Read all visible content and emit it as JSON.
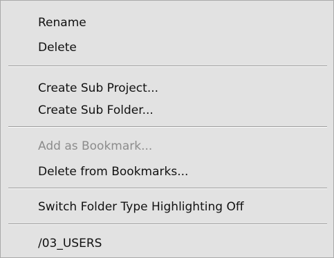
{
  "context_menu": {
    "groups": [
      {
        "items": [
          {
            "label": "Rename",
            "enabled": true
          },
          {
            "label": "Delete",
            "enabled": true
          }
        ]
      },
      {
        "items": [
          {
            "label": "Create Sub Project...",
            "enabled": true
          },
          {
            "label": "Create Sub Folder...",
            "enabled": true
          }
        ]
      },
      {
        "items": [
          {
            "label": "Add as Bookmark...",
            "enabled": false
          },
          {
            "label": "Delete from Bookmarks...",
            "enabled": true
          }
        ]
      },
      {
        "items": [
          {
            "label": "Switch Folder Type Highlighting Off",
            "enabled": true
          }
        ]
      },
      {
        "items": [
          {
            "label": "/03_USERS",
            "enabled": true
          }
        ]
      }
    ]
  },
  "colors": {
    "menu_background": "#e2e2e2",
    "text": "#111111",
    "disabled_text": "#8c8c8c",
    "separator": "#9b9b9b"
  }
}
